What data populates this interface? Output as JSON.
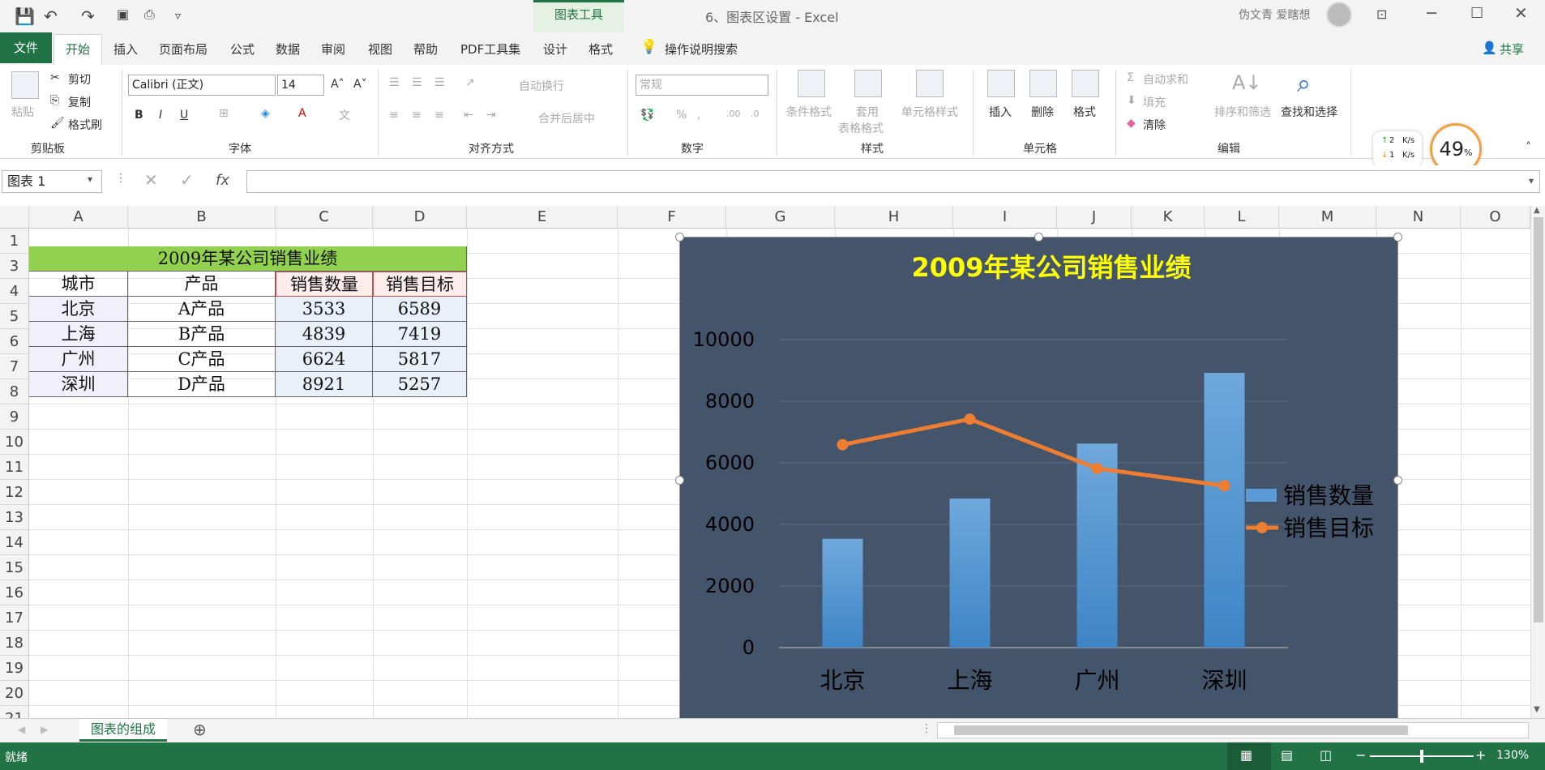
{
  "titlebar": {
    "window_title": "6、图表区设置 - Excel",
    "context_group": "图表工具",
    "user_name": "伪文青 爱瞎想"
  },
  "tabs": [
    "文件",
    "开始",
    "插入",
    "页面布局",
    "公式",
    "数据",
    "审阅",
    "视图",
    "帮助",
    "PDF工具集",
    "设计",
    "格式",
    "操作说明搜索",
    "共享"
  ],
  "ribbon": {
    "clipboard": {
      "paste": "粘贴",
      "cut": "剪切",
      "copy": "复制",
      "format_painter": "格式刷",
      "label": "剪贴板"
    },
    "font": {
      "name": "Calibri (正文)",
      "size": "14",
      "label": "字体",
      "bold": "B",
      "italic": "I",
      "underline": "U"
    },
    "align": {
      "wrap": "自动换行",
      "merge": "合并后居中",
      "label": "对齐方式"
    },
    "number": {
      "format": "常规",
      "label": "数字"
    },
    "styles": {
      "cond": "条件格式",
      "table1": "套用",
      "table2": "表格格式",
      "cell": "单元格样式",
      "label": "样式"
    },
    "cells": {
      "insert": "插入",
      "delete": "删除",
      "format": "格式",
      "label": "单元格"
    },
    "editing": {
      "autosum": "自动求和",
      "fill": "填充",
      "clear": "清除",
      "sort": "排序和筛选",
      "find": "查找和选择",
      "label": "编辑"
    }
  },
  "net_widget": {
    "up": "2",
    "down": "1",
    "unit": "K/s",
    "percent": "49",
    "pct_sign": "%"
  },
  "formula_bar": {
    "name_box": "图表 1",
    "fx": "fx"
  },
  "columns": [
    "A",
    "B",
    "C",
    "D",
    "E",
    "F",
    "G",
    "H",
    "I",
    "J",
    "K",
    "L",
    "M",
    "N",
    "O"
  ],
  "rows": [
    "1",
    "3",
    "4",
    "5",
    "6",
    "7",
    "8",
    "9",
    "10",
    "11",
    "12",
    "13",
    "14",
    "15",
    "16",
    "17",
    "18",
    "19",
    "20",
    "21"
  ],
  "table": {
    "title": "2009年某公司销售业绩",
    "headers": [
      "城市",
      "产品",
      "销售数量",
      "销售目标"
    ],
    "rows": [
      [
        "北京",
        "A产品",
        "3533",
        "6589"
      ],
      [
        "上海",
        "B产品",
        "4839",
        "7419"
      ],
      [
        "广州",
        "C产品",
        "6624",
        "5817"
      ],
      [
        "深圳",
        "D产品",
        "8921",
        "5257"
      ]
    ]
  },
  "chart_data": {
    "type": "bar",
    "title": "2009年某公司销售业绩",
    "categories": [
      "北京",
      "上海",
      "广州",
      "深圳"
    ],
    "series": [
      {
        "name": "销售数量",
        "kind": "bar",
        "values": [
          3533,
          4839,
          6624,
          8921
        ],
        "color": "#5b9bd5"
      },
      {
        "name": "销售目标",
        "kind": "line",
        "values": [
          6589,
          7419,
          5817,
          5257
        ],
        "color": "#ed7d31"
      }
    ],
    "ylim": [
      0,
      10000
    ],
    "yticks": [
      "0",
      "2000",
      "4000",
      "6000",
      "8000",
      "10000"
    ],
    "grid": true,
    "legend": "right",
    "background": "#44546a",
    "title_color": "#ffff00"
  },
  "sheet_tab": "图表的组成",
  "status": {
    "ready": "就绪",
    "zoom": "130%"
  }
}
